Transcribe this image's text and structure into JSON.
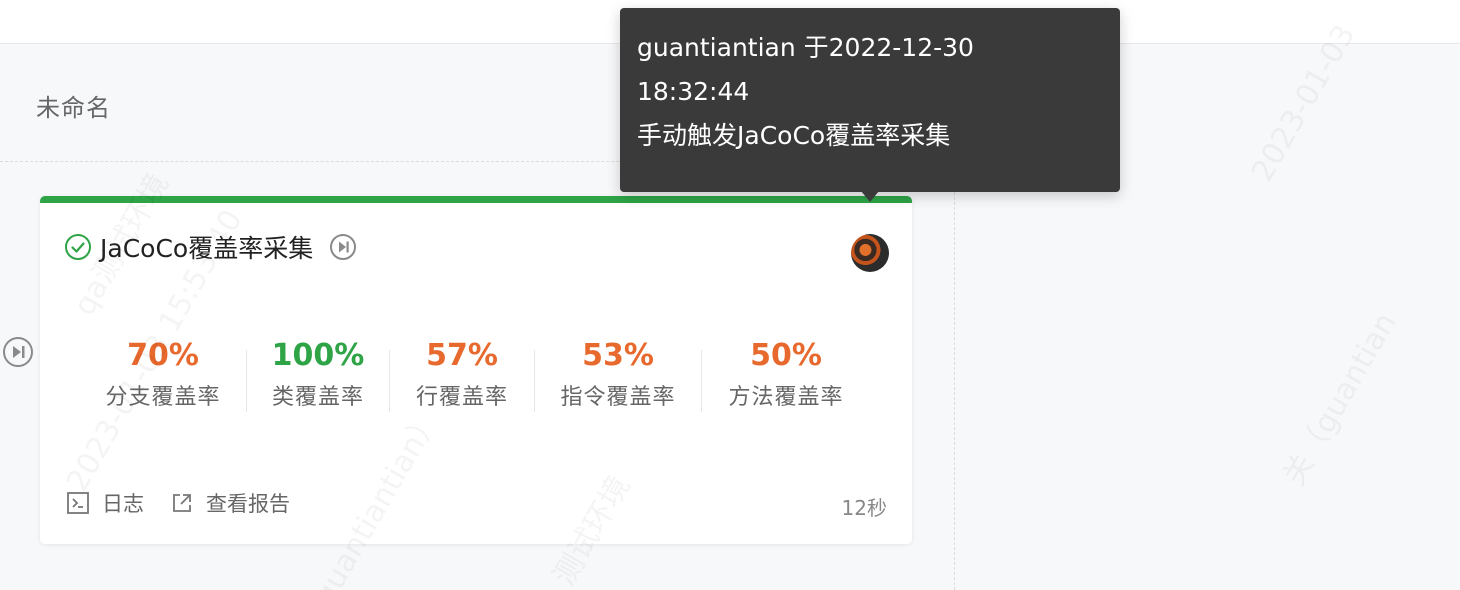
{
  "stage": {
    "title": "未命名"
  },
  "card": {
    "status_color": "#2ea447",
    "status_icon": "check-circle-icon",
    "title": "JaCoCo覆盖率采集",
    "metrics": [
      {
        "value": "70%",
        "label": "分支覆盖率",
        "color": "#e8692d"
      },
      {
        "value": "100%",
        "label": "类覆盖率",
        "color": "#2ea447"
      },
      {
        "value": "57%",
        "label": "行覆盖率",
        "color": "#e8692d"
      },
      {
        "value": "53%",
        "label": "指令覆盖率",
        "color": "#e8692d"
      },
      {
        "value": "50%",
        "label": "方法覆盖率",
        "color": "#e8692d"
      }
    ],
    "footer": {
      "log_label": "日志",
      "report_label": "查看报告"
    },
    "duration": "12秒"
  },
  "tooltip": {
    "line1": "guantiantian 于2022-12-30",
    "line2": "18:32:44",
    "line3": "手动触发JaCoCo覆盖率采集"
  },
  "watermarks": [
    "qa测试环境",
    "2023-01-03 15:53:40",
    "guantiantian）",
    "测试环境",
    "2023-01-03",
    "关（guantian"
  ]
}
